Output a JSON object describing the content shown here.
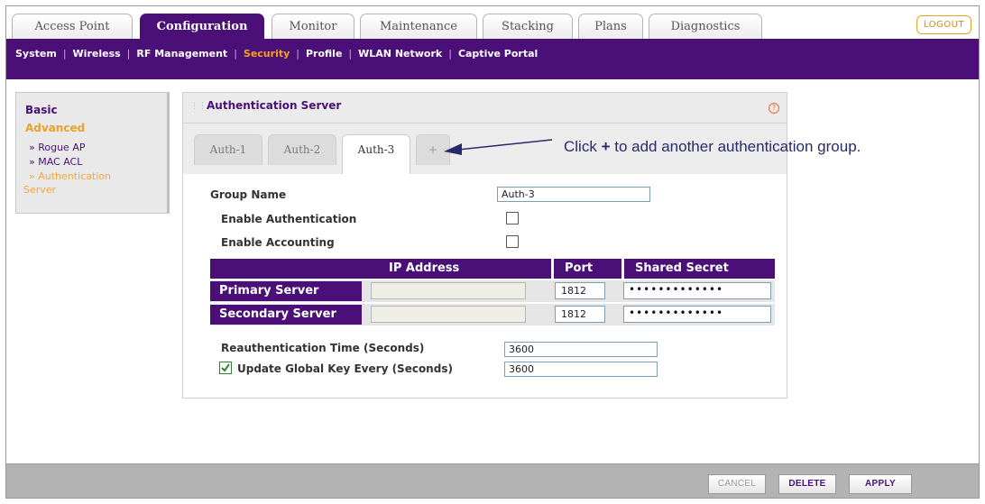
{
  "top_tabs": [
    "Access Point",
    "Configuration",
    "Monitor",
    "Maintenance",
    "Stacking",
    "Plans",
    "Diagnostics"
  ],
  "logout_label": "LOGOUT",
  "subnav": [
    "System",
    "Wireless",
    "RF Management",
    "Security",
    "Profile",
    "WLAN Network",
    "Captive Portal"
  ],
  "left_menu": {
    "basic": "Basic",
    "advanced": "Advanced",
    "items": [
      "» Rogue AP",
      "» MAC ACL",
      "» Authentication",
      "Server"
    ]
  },
  "panel": {
    "title": "Authentication Server",
    "help_icon": "?",
    "tabs": [
      "Auth-1",
      "Auth-2",
      "Auth-3",
      "+"
    ]
  },
  "form": {
    "group_name_label": "Group Name",
    "group_name_value": "Auth-3",
    "enable_auth_label": "Enable Authentication",
    "enable_acct_label": "Enable Accounting",
    "reauth_label": "Reauthentication Time (Seconds)",
    "reauth_value": "3600",
    "global_key_label": "Update Global Key Every (Seconds)",
    "global_key_value": "3600"
  },
  "server_table": {
    "headers": [
      "IP Address",
      "Port",
      "Shared Secret"
    ],
    "rows": [
      {
        "label": "Primary Server",
        "ip": "",
        "port": "1812",
        "secret": "•••••••••••••"
      },
      {
        "label": "Secondary Server",
        "ip": "",
        "port": "1812",
        "secret": "•••••••••••••"
      }
    ]
  },
  "callout": {
    "prefix": "Click ",
    "plus": "+",
    "suffix": " to add another authentication group."
  },
  "buttons": {
    "cancel": "CANCEL",
    "delete": "DELETE",
    "apply": "APPLY"
  },
  "colors": {
    "brand_purple": "#4a1078",
    "accent_orange": "#f7a11a"
  }
}
